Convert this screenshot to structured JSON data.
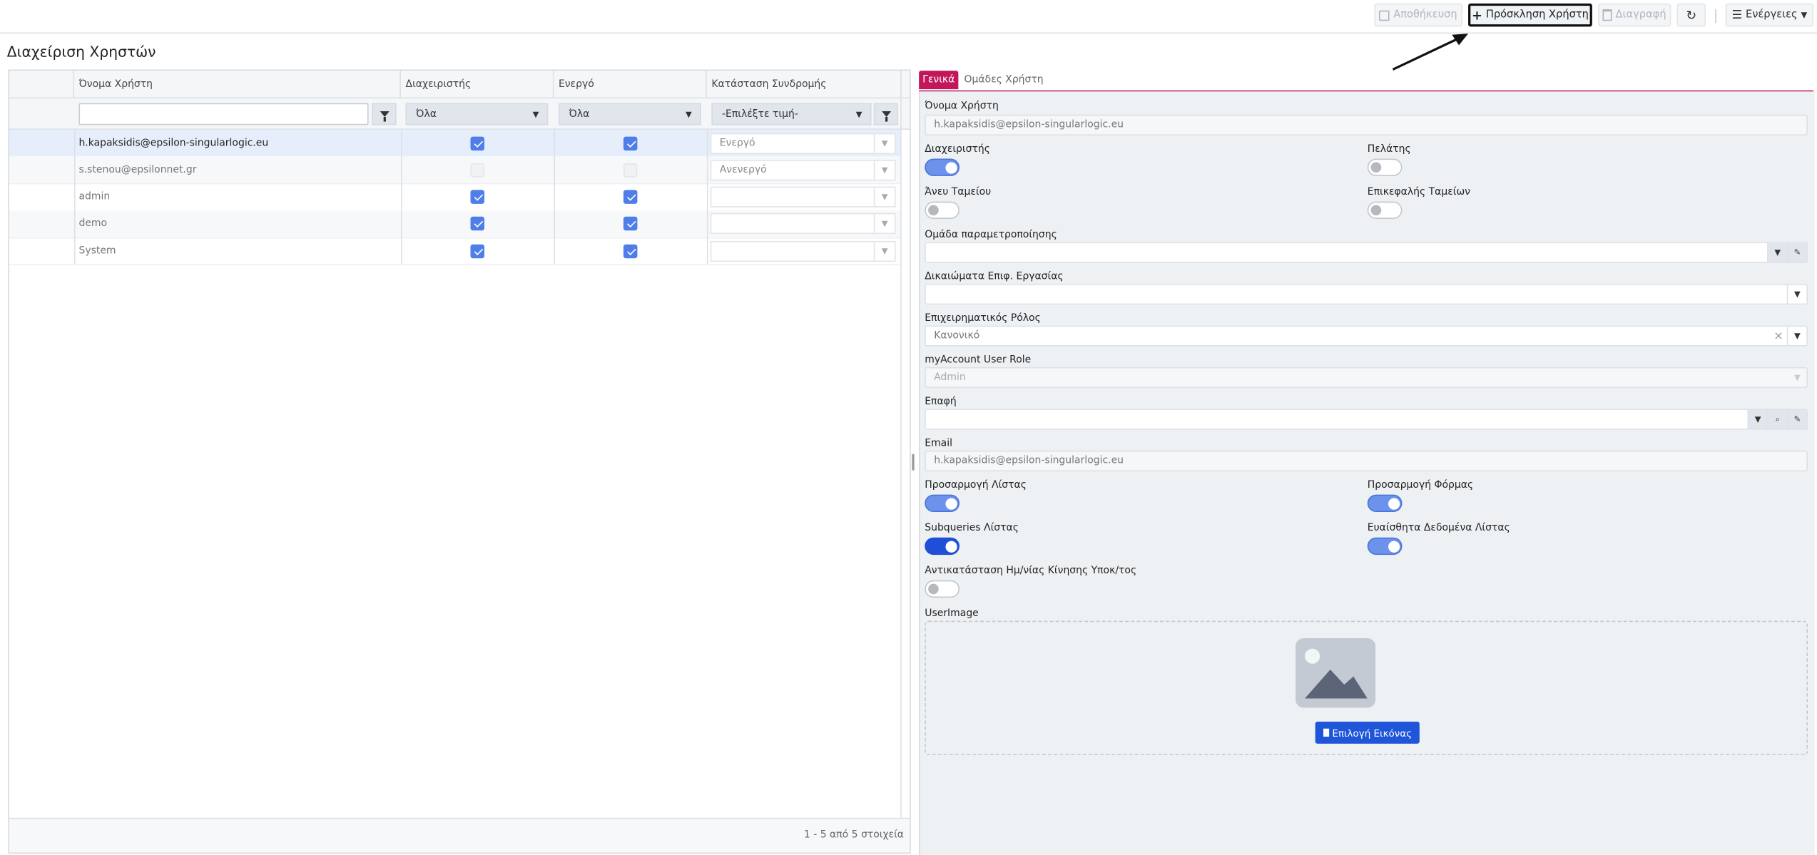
{
  "toolbar": {
    "save_label": "Αποθήκευση",
    "invite_label": "Πρόσκληση Χρήστη",
    "delete_label": "Διαγραφή",
    "actions_label": "Ενέργειες"
  },
  "page": {
    "title": "Διαχείριση Χρηστών"
  },
  "grid": {
    "columns": [
      "Όνομα Χρήστη",
      "Διαχειριστής",
      "Ενεργό",
      "Κατάσταση Συνδρομής"
    ],
    "filters": {
      "username_value": "",
      "admin_value": "Όλα",
      "active_value": "Όλα",
      "subscription_value": "-Επιλέξτε τιμή-"
    },
    "rows": [
      {
        "username": "h.kapaksidis@epsilon-singularlogic.eu",
        "admin": true,
        "active": true,
        "subscription": "Ενεργό",
        "selected": true
      },
      {
        "username": "s.stenou@epsilonnet.gr",
        "admin": false,
        "active": false,
        "subscription": "Ανενεργό"
      },
      {
        "username": "admin",
        "admin": true,
        "active": true,
        "subscription": ""
      },
      {
        "username": "demo",
        "admin": true,
        "active": true,
        "subscription": ""
      },
      {
        "username": "System",
        "admin": true,
        "active": true,
        "subscription": ""
      }
    ],
    "pager_text": "1 - 5 από 5 στοιχεία"
  },
  "detail": {
    "tabs": [
      "Γενικά",
      "Ομάδες Χρήστη"
    ],
    "labels": {
      "username": "Όνομα Χρήστη",
      "admin": "Διαχειριστής",
      "customer": "Πελάτης",
      "no_cashbox": "Άνευ Ταμείου",
      "head_cashbox": "Επικεφαλής Ταμείων",
      "param_group": "Ομάδα παραμετροποίησης",
      "task_rights": "Δικαιώματα Επιφ. Εργασίας",
      "business_role": "Επιχειρηματικός Ρόλος",
      "myaccount_role": "myAccount User Role",
      "contact": "Επαφή",
      "email": "Email",
      "list_custom": "Προσαρμογή Λίστας",
      "form_custom": "Προσαρμογή Φόρμας",
      "subqueries": "Subqueries Λίστας",
      "sensitive": "Ευαίσθητα Δεδομένα Λίστας",
      "replace_date": "Αντικατάσταση Ημ/νίας Κίνησης Υποκ/τος",
      "user_image": "UserImage"
    },
    "values": {
      "username": "h.kapaksidis@epsilon-singularlogic.eu",
      "param_group": "",
      "task_rights": "",
      "business_role": "Κανονικό",
      "myaccount_role": "Admin",
      "contact": "",
      "email": "h.kapaksidis@epsilon-singularlogic.eu"
    },
    "toggles": {
      "admin": true,
      "customer": false,
      "no_cashbox": false,
      "head_cashbox": false,
      "list_custom": true,
      "form_custom": true,
      "subqueries": true,
      "sensitive": true,
      "replace_date": false
    },
    "pick_image_label": "Επιλογή Εικόνας"
  },
  "colors": {
    "accent_tab": "#c2185b",
    "primary": "#1f56d9",
    "checkbox": "#4f7ee8"
  }
}
